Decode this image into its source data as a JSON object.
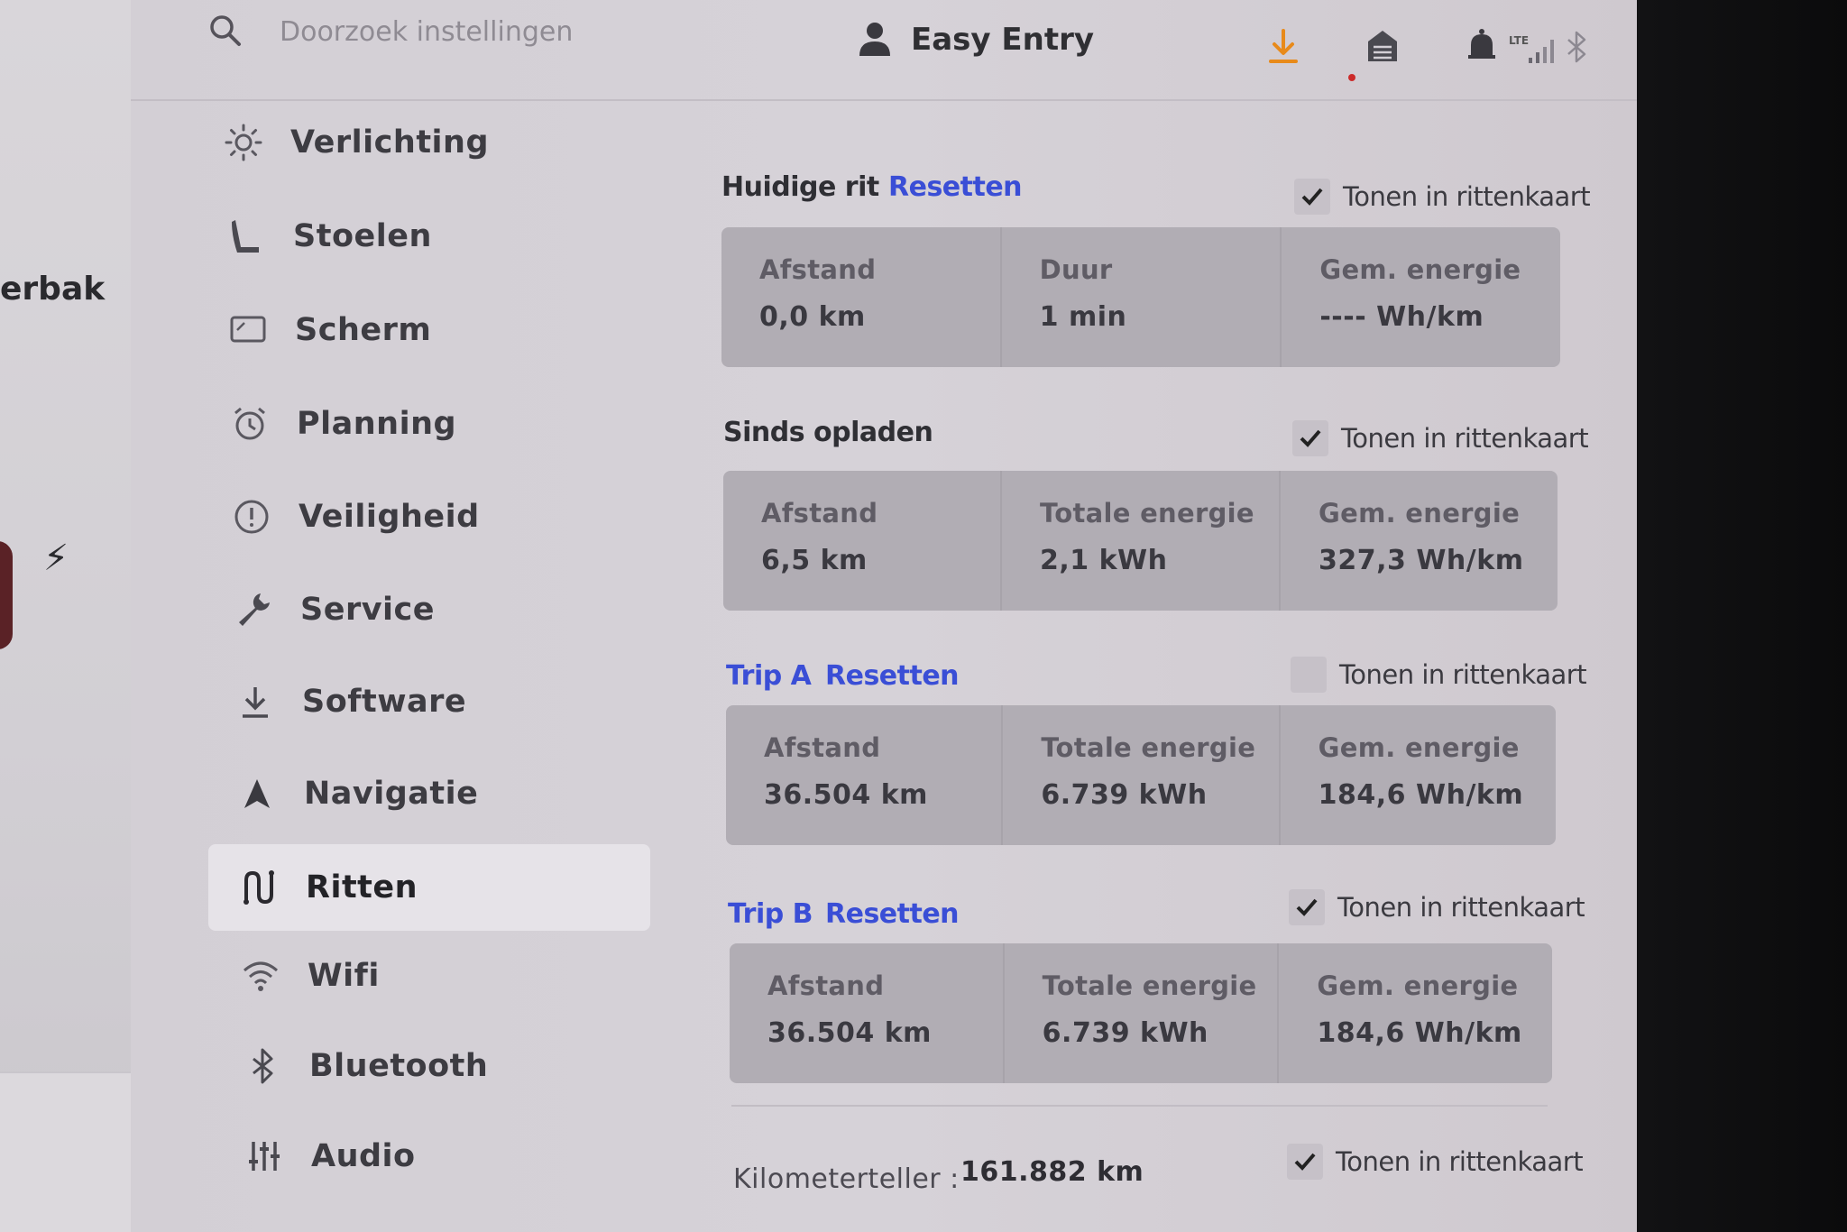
{
  "left_panel": {
    "partial_label": "erbak"
  },
  "header": {
    "search_placeholder": "Doorzoek instellingen",
    "profile_label": "Easy Entry",
    "lte_label": "LTE",
    "icons": [
      "search-icon",
      "user-icon",
      "download-icon",
      "garage-icon",
      "bell-icon",
      "bluetooth-icon",
      "signal-icon"
    ],
    "download_color": "#e88a1a"
  },
  "sidebar": {
    "items": [
      {
        "label": "Verlichting",
        "icon": "sun-icon"
      },
      {
        "label": "Stoelen",
        "icon": "seat-icon"
      },
      {
        "label": "Scherm",
        "icon": "display-icon"
      },
      {
        "label": "Planning",
        "icon": "alarm-clock-icon"
      },
      {
        "label": "Veiligheid",
        "icon": "alert-circle-icon"
      },
      {
        "label": "Service",
        "icon": "wrench-icon"
      },
      {
        "label": "Software",
        "icon": "download-icon"
      },
      {
        "label": "Navigatie",
        "icon": "navigation-arrow-icon"
      },
      {
        "label": "Ritten",
        "icon": "trips-icon",
        "active": true
      },
      {
        "label": "Wifi",
        "icon": "wifi-icon"
      },
      {
        "label": "Bluetooth",
        "icon": "bluetooth-icon"
      },
      {
        "label": "Audio",
        "icon": "equalizer-icon"
      }
    ]
  },
  "sections": {
    "current_trip": {
      "title": "Huidige rit",
      "reset": "Resetten",
      "show_label": "Tonen in rittenkaart",
      "checked": true,
      "cells": [
        {
          "label": "Afstand",
          "value": "0,0  km"
        },
        {
          "label": "Duur",
          "value": "1 min"
        },
        {
          "label": "Gem. energie",
          "value": "----  Wh/km"
        }
      ]
    },
    "since_charge": {
      "title": "Sinds opladen",
      "show_label": "Tonen in rittenkaart",
      "checked": true,
      "cells": [
        {
          "label": "Afstand",
          "value": "6,5  km"
        },
        {
          "label": "Totale energie",
          "value": "2,1  kWh"
        },
        {
          "label": "Gem. energie",
          "value": "327,3  Wh/km"
        }
      ]
    },
    "trip_a": {
      "title": "Trip A",
      "reset": "Resetten",
      "show_label": "Tonen in rittenkaart",
      "checked": false,
      "cells": [
        {
          "label": "Afstand",
          "value": "36.504  km"
        },
        {
          "label": "Totale energie",
          "value": "6.739  kWh"
        },
        {
          "label": "Gem. energie",
          "value": "184,6  Wh/km"
        }
      ]
    },
    "trip_b": {
      "title": "Trip B",
      "reset": "Resetten",
      "show_label": "Tonen in rittenkaart",
      "checked": true,
      "cells": [
        {
          "label": "Afstand",
          "value": "36.504  km"
        },
        {
          "label": "Totale energie",
          "value": "6.739  kWh"
        },
        {
          "label": "Gem. energie",
          "value": "184,6  Wh/km"
        }
      ]
    },
    "odometer": {
      "label": "Kilometerteller  :",
      "value": "161.882  km",
      "show_label": "Tonen in rittenkaart",
      "checked": true
    }
  },
  "colors": {
    "accent_blue": "#3a4ed6",
    "active_bg": "#e6e3e8",
    "card_bg": "#b1adb4"
  }
}
